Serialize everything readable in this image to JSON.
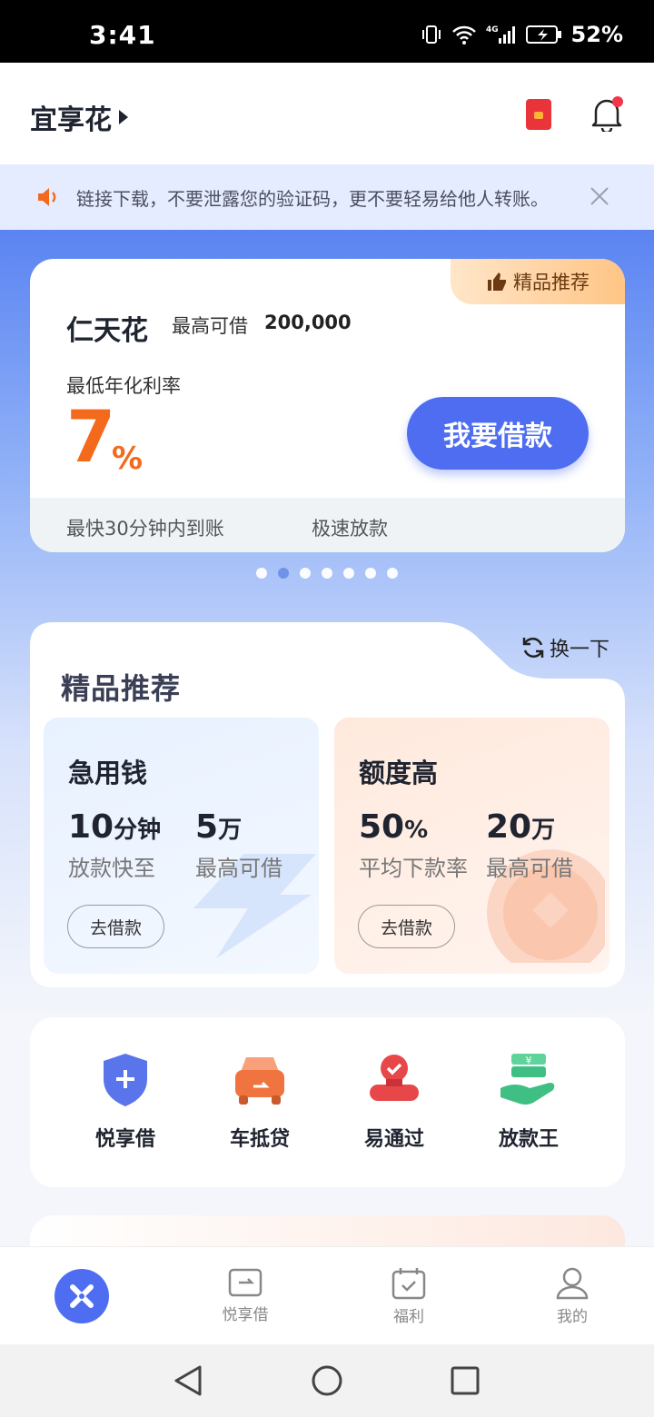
{
  "status_bar": {
    "time": "3:41",
    "battery": "52%",
    "network": "4G"
  },
  "header": {
    "app_name": "宜享花"
  },
  "notice": {
    "text": "链接下载，不要泄露您的验证码，更不要轻易给他人转账。"
  },
  "loan_card": {
    "tag": "精品推荐",
    "product_name": "仁天花",
    "limit_label": "最高可借",
    "limit_value": "200,000",
    "rate_label": "最低年化利率",
    "rate_value": "7",
    "rate_unit": "%",
    "button": "我要借款",
    "footer_left": "最快30分钟内到账",
    "footer_right": "极速放款"
  },
  "carousel": {
    "count": 7,
    "active": 1
  },
  "recommend": {
    "title": "精品推荐",
    "swap_label": "换一下",
    "cards": [
      {
        "title": "急用钱",
        "metric1_value": "10",
        "metric1_unit": "分钟",
        "metric1_label": "放款快至",
        "metric2_value": "5",
        "metric2_unit": "万",
        "metric2_label": "最高可借",
        "button": "去借款"
      },
      {
        "title": "额度高",
        "metric1_value": "50",
        "metric1_unit": "%",
        "metric1_label": "平均下款率",
        "metric2_value": "20",
        "metric2_unit": "万",
        "metric2_label": "最高可借",
        "button": "去借款"
      }
    ]
  },
  "quick_entries": [
    {
      "label": "悦享借",
      "icon": "shield-plus-icon"
    },
    {
      "label": "车抵贷",
      "icon": "car-icon"
    },
    {
      "label": "易通过",
      "icon": "stamp-icon"
    },
    {
      "label": "放款王",
      "icon": "money-hand-icon"
    }
  ],
  "bottom_nav": [
    {
      "label": "",
      "icon": "home-logo-icon"
    },
    {
      "label": "悦享借",
      "icon": "loan-icon"
    },
    {
      "label": "福利",
      "icon": "calendar-icon"
    },
    {
      "label": "我的",
      "icon": "user-icon"
    }
  ],
  "colors": {
    "primary": "#4e6df0",
    "accent": "#f46a1d",
    "notice_bg": "#e6ecff"
  }
}
